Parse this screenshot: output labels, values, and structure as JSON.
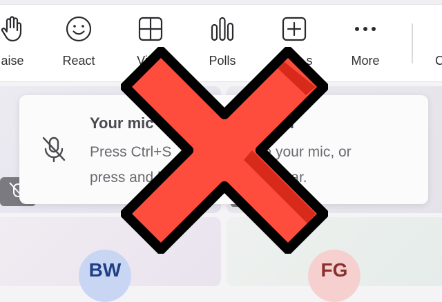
{
  "toolbar": {
    "items": [
      {
        "label": "aise",
        "icon": "hand-icon"
      },
      {
        "label": "React",
        "icon": "smiley-icon"
      },
      {
        "label": "Vi",
        "icon": "grid-icon"
      },
      {
        "label": "Polls",
        "icon": "polls-icon"
      },
      {
        "label": "s",
        "icon": "plus-square-icon"
      },
      {
        "label": "More",
        "icon": "more-dots-icon"
      },
      {
        "label": "C",
        "icon": ""
      }
    ]
  },
  "toast": {
    "title": "Your mic",
    "title_tail": "d",
    "body_line1_left": "Press Ctrl+S",
    "body_line1_right": "mute your mic, or",
    "body_line2_left": "press and h",
    "body_line2_right": "acebar.",
    "icon": "mic-off-icon"
  },
  "participants": [
    {
      "initials": "BW"
    },
    {
      "initials": "FG"
    }
  ],
  "overlay": {
    "icon": "big-x-icon",
    "fill": "#ff4d3d",
    "shade": "#d82a1b",
    "stroke": "#000000"
  }
}
